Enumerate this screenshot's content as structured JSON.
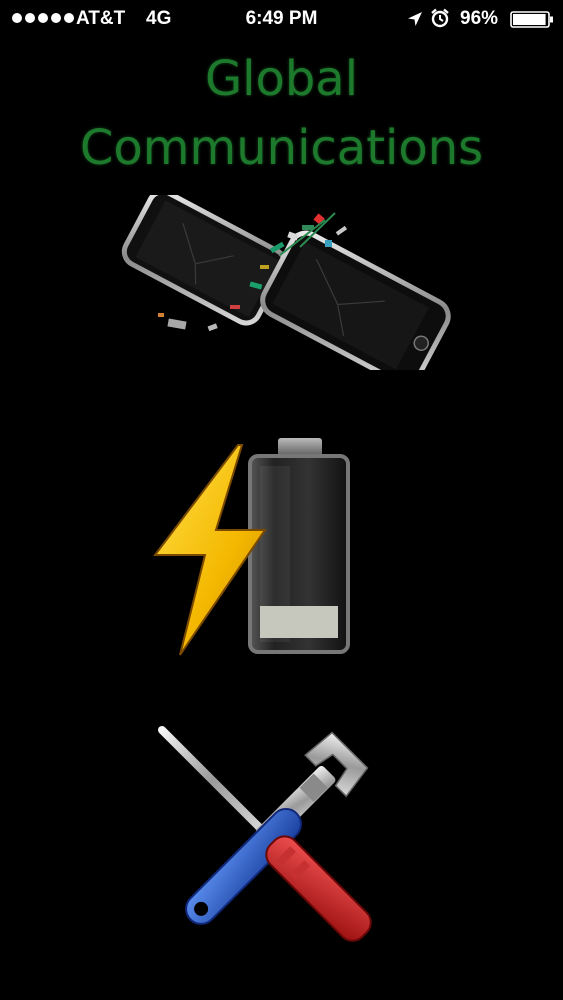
{
  "status_bar": {
    "signal_dots": 5,
    "carrier": "AT&T",
    "network": "4G",
    "time": "6:49 PM",
    "battery_percent": "96%",
    "battery_level": 0.96,
    "icons": [
      "location-arrow-icon",
      "alarm-clock-icon",
      "battery-icon"
    ]
  },
  "app": {
    "title_line1": "Global",
    "title_line2": "Communications",
    "title_color": "#1d7a2c"
  },
  "menu": {
    "items": [
      {
        "name": "cracked-screen-repair",
        "icon": "broken-phone-icon"
      },
      {
        "name": "battery-replacement",
        "icon": "charging-battery-icon"
      },
      {
        "name": "tools-repair",
        "icon": "wrench-screwdriver-icon"
      }
    ]
  }
}
